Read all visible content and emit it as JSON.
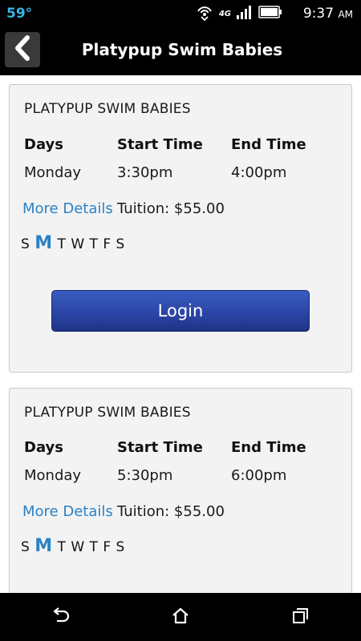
{
  "status_bar": {
    "temperature": "59°",
    "network": "4G",
    "time": "9:37",
    "ampm": "AM"
  },
  "header": {
    "title": "Platypup Swim Babies"
  },
  "col_headers": {
    "days": "Days",
    "start": "Start Time",
    "end": "End Time"
  },
  "classes": [
    {
      "title": "PLATYPUP SWIM BABIES",
      "day": "Monday",
      "start": "3:30pm",
      "end": "4:00pm",
      "more_details": "More Details",
      "tuition": "Tuition: $55.00",
      "weekdays": [
        "S",
        "M",
        "T",
        "W",
        "T",
        "F",
        "S"
      ],
      "active_day": "M",
      "login_label": "Login"
    },
    {
      "title": "PLATYPUP SWIM BABIES",
      "day": "Monday",
      "start": "5:30pm",
      "end": "6:00pm",
      "more_details": "More Details",
      "tuition": "Tuition: $55.00",
      "weekdays": [
        "S",
        "M",
        "T",
        "W",
        "T",
        "F",
        "S"
      ],
      "active_day": "M"
    }
  ],
  "colors": {
    "link": "#2a82c4",
    "button": "#2b45a6",
    "temperature": "#3ab4e8"
  }
}
